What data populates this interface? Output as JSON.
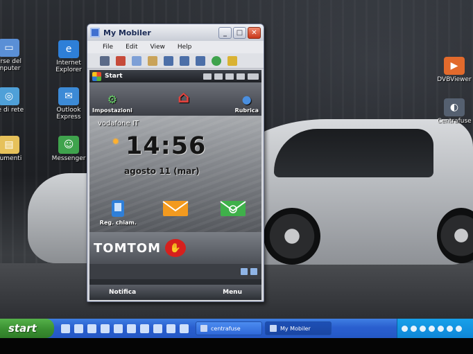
{
  "desktop": {
    "icons_left": [
      {
        "label": "orse del\nmputer",
        "icon": "my-computer-icon"
      },
      {
        "label": "se di rete",
        "icon": "network-icon"
      },
      {
        "label": "cumenti",
        "icon": "documents-icon"
      }
    ],
    "icons_mid": [
      {
        "label": "Internet\nExplorer",
        "icon": "internet-explorer-icon"
      },
      {
        "label": "Outlook\nExpress",
        "icon": "outlook-express-icon"
      },
      {
        "label": "Messenger",
        "icon": "messenger-icon"
      }
    ],
    "icons_right": [
      {
        "label": "DVBViewer",
        "icon": "dvbviewer-icon"
      },
      {
        "label": "Centrafuse",
        "icon": "centrafuse-icon"
      }
    ]
  },
  "window": {
    "title": "My Mobiler",
    "menu": [
      "File",
      "Edit",
      "View",
      "Help"
    ]
  },
  "device": {
    "start_label": "Start",
    "shortcuts": {
      "left": "Impostazioni",
      "right": "Rubrica"
    },
    "operator": "vodafone IT",
    "time": "14:56",
    "date": "agosto 11 (mar)",
    "apps": [
      "Reg. chiam.",
      "",
      ""
    ],
    "tomtom": "TOMTOM",
    "softkeys": {
      "left": "Notifica",
      "right": "Menu"
    }
  },
  "taskbar": {
    "start": "start",
    "tasks": [
      {
        "label": "centrafuse",
        "active": false
      },
      {
        "label": "My Mobiler",
        "active": true
      }
    ]
  }
}
